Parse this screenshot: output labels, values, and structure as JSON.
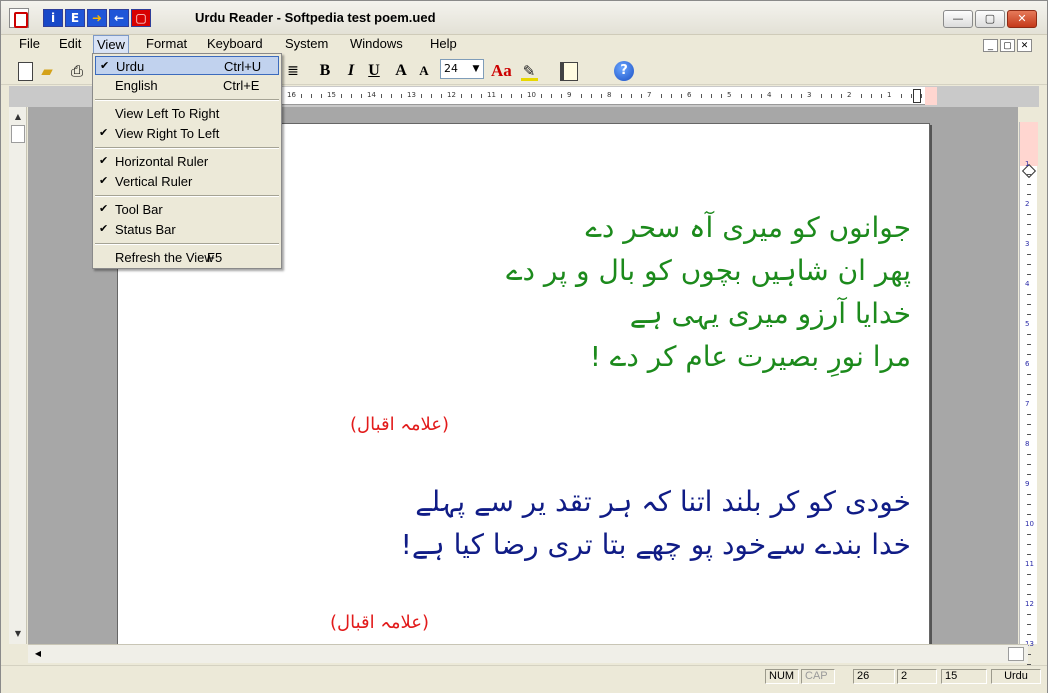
{
  "window": {
    "title": "Urdu Reader - Softpedia test poem.ued",
    "quick_buttons": [
      "i",
      "E",
      "➜",
      "←",
      "▢"
    ],
    "controls": {
      "minimize": "—",
      "maximize": "▢",
      "close": "✕"
    }
  },
  "menubar": {
    "items": [
      "File",
      "Edit",
      "View",
      "Format",
      "Keyboard",
      "System",
      "Windows",
      "Help"
    ],
    "mdi_controls": [
      "_",
      "▢",
      "✕"
    ]
  },
  "toolbar": {
    "font_size": "24",
    "icons": {
      "bold": "B",
      "italic": "I",
      "underline": "U",
      "grow": "A",
      "shrink": "A",
      "font_color": "Aa",
      "help": "?"
    }
  },
  "ruler": {
    "horizontal_numbers": [
      "16",
      "15",
      "14",
      "13",
      "12",
      "11",
      "10",
      "9",
      "8",
      "7",
      "6",
      "5",
      "4",
      "3",
      "2",
      "1"
    ],
    "vertical_numbers": [
      "1",
      "2",
      "3",
      "4",
      "5",
      "6",
      "7",
      "8",
      "9",
      "10",
      "11",
      "12",
      "13"
    ]
  },
  "document": {
    "poem1_lines": [
      "جوانوں کو میری آہ سحر دے",
      "پھر ان شاہیں بچوں کو بال و پر دے",
      "خدایا آرزو میری یہی ہے",
      "مرا نورِ بصیرت عام کر دے !"
    ],
    "attribution1": "(علامہ اقبال)",
    "poem2_lines": [
      "خودی کو کر بلند اتنا کہ ہر تقد یر سے پہلے",
      "خدا بندے سےخود پو چھے بتا تری رضا کیا ہے!"
    ],
    "attribution2": "(علامہ اقبال)",
    "colors": {
      "poem1": "#1c8a1c",
      "poem2": "#101c86",
      "attribution": "#e21b1b"
    }
  },
  "view_menu": {
    "items": [
      {
        "label": "Urdu",
        "shortcut": "Ctrl+U",
        "checked": true,
        "highlighted": true
      },
      {
        "label": "English",
        "shortcut": "Ctrl+E",
        "checked": false
      },
      {
        "label": "View Left To Right",
        "shortcut": "",
        "checked": false
      },
      {
        "label": "View Right To Left",
        "shortcut": "",
        "checked": true
      },
      {
        "label": "Horizontal Ruler",
        "shortcut": "",
        "checked": true
      },
      {
        "label": "Vertical Ruler",
        "shortcut": "",
        "checked": true
      },
      {
        "label": "Tool Bar",
        "shortcut": "",
        "checked": true
      },
      {
        "label": "Status Bar",
        "shortcut": "",
        "checked": true
      },
      {
        "label": "Refresh the View",
        "shortcut": "F5",
        "checked": false
      }
    ]
  },
  "statusbar": {
    "num": "NUM",
    "cap": "CAP",
    "line": "26",
    "column": "2",
    "position": "15",
    "language": "Urdu"
  }
}
